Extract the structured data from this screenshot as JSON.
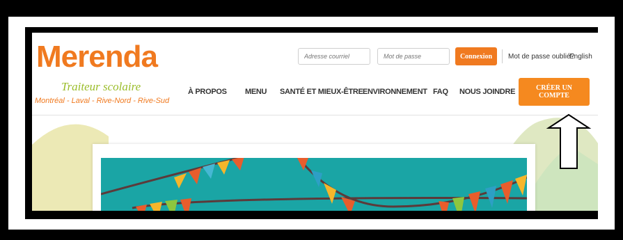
{
  "brand": {
    "name": "Merenda",
    "tagline": "Traiteur scolaire",
    "regions": "Montréal - Laval - Rive-Nord - Rive-Sud"
  },
  "login": {
    "email_placeholder": "Adresse courriel",
    "password_placeholder": "Mot de passe",
    "submit_label": "Connexion",
    "forgot_label": "Mot de passe oublié?",
    "language_label": "English"
  },
  "nav": {
    "items": [
      {
        "label": "À PROPOS"
      },
      {
        "label": "MENU"
      },
      {
        "label": "SANTÉ ET MIEUX-ÊTRE"
      },
      {
        "label": "ENVIRONNEMENT"
      },
      {
        "label": "FAQ"
      },
      {
        "label": "NOUS JOINDRE"
      }
    ],
    "cta_label": "CRÉER UN COMPTE"
  },
  "colors": {
    "brand_orange": "#f07a20",
    "tagline_green": "#9bbd2a",
    "banner_teal": "#1aa5a5"
  }
}
